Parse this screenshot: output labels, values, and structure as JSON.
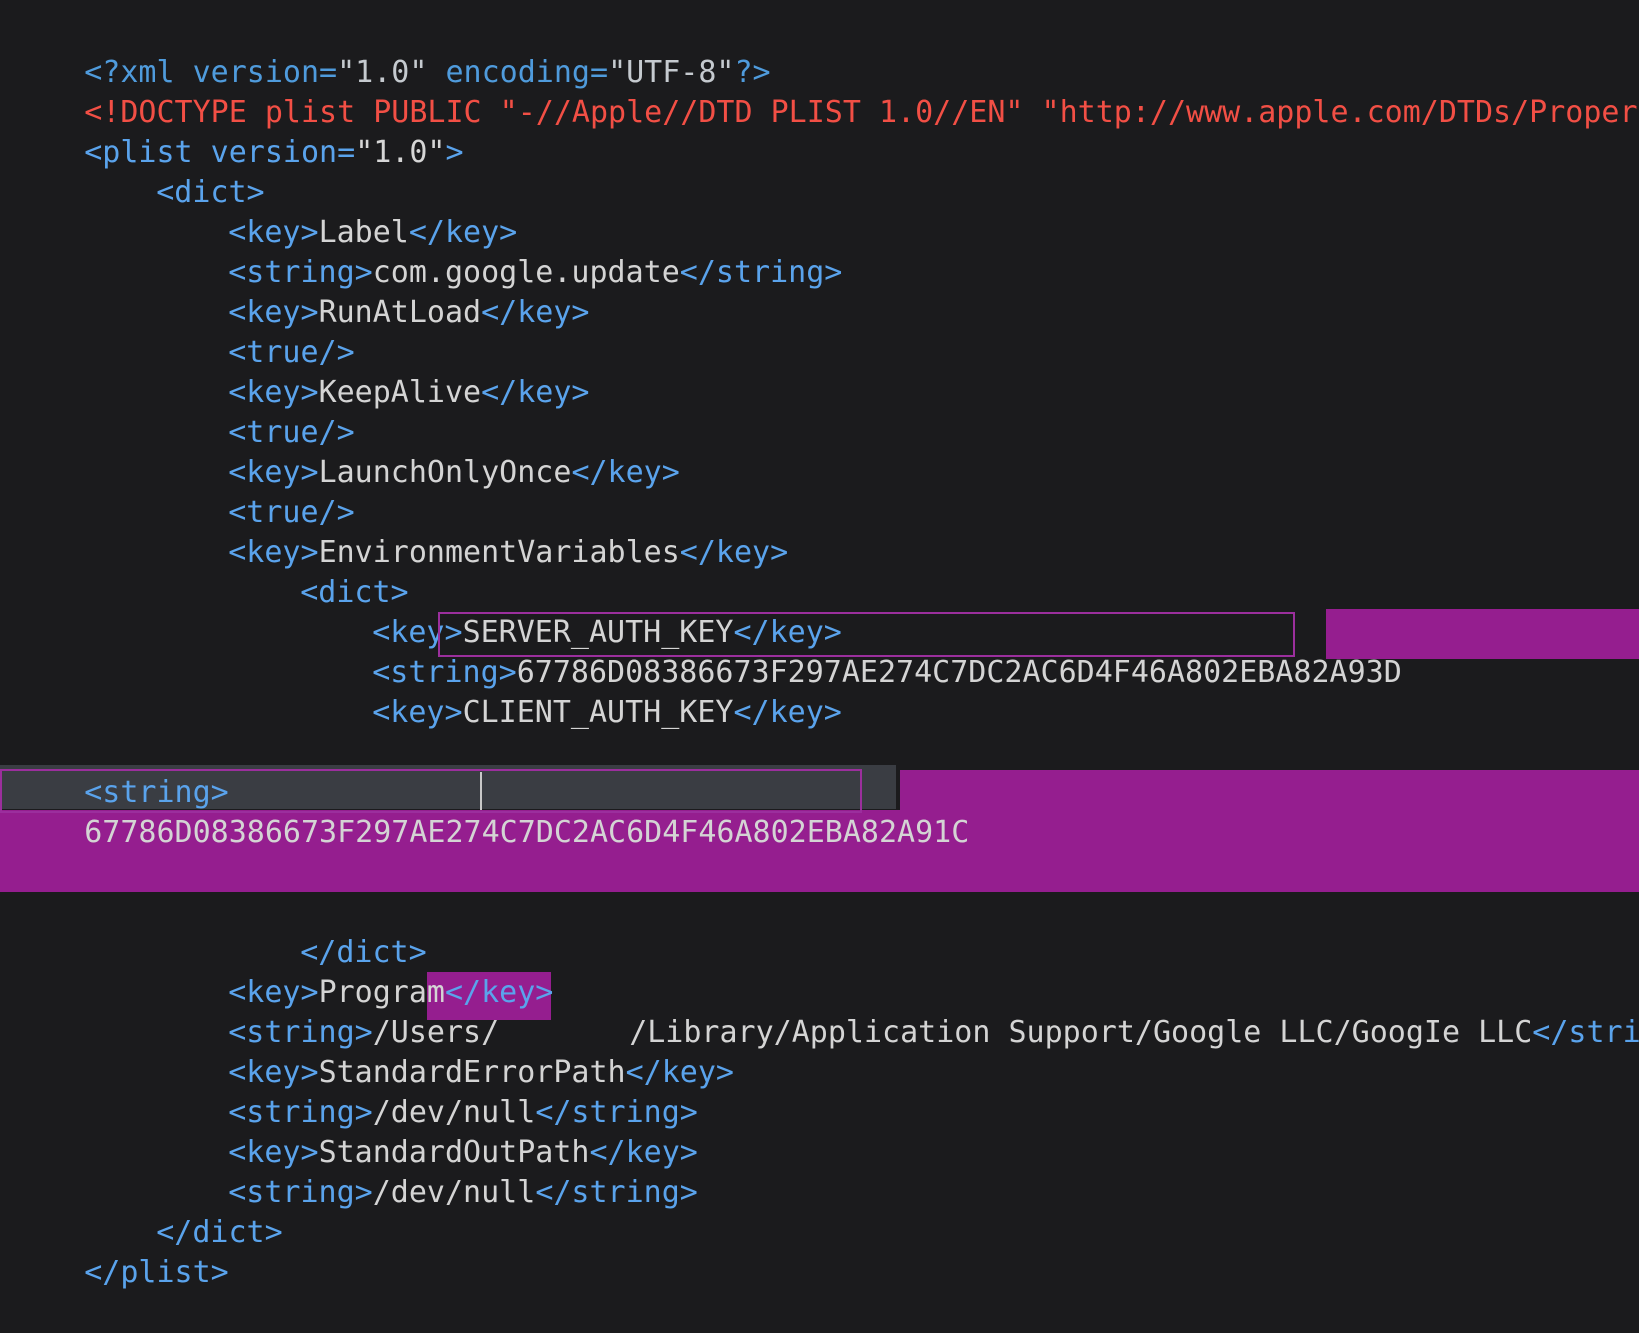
{
  "colors": {
    "background": "#1b1b1d",
    "tag": "#5aa3ec",
    "text": "#d4d4d4",
    "doctype": "#f24f45",
    "redaction": "#951e8f",
    "selection_border": "#9b2f9d"
  },
  "lines": {
    "l1": {
      "open": "<?xml version=",
      "v1": "\"1.0\"",
      "mid": " encoding=",
      "v2": "\"UTF-8\"",
      "close": "?>"
    },
    "l2": {
      "text": "<!DOCTYPE plist PUBLIC \"-//Apple//DTD PLIST 1.0//EN\" \"http://www.apple.com/DTDs/PropertyLi"
    },
    "l3": {
      "open": "<plist",
      "attr": " version=",
      "val": "\"1.0\"",
      "close": ">"
    },
    "l4": {
      "tag": "<dict>"
    },
    "l5": {
      "open": "<key>",
      "val": "Label",
      "close": "</key>"
    },
    "l6": {
      "open": "<string>",
      "val": "com.google.update",
      "close": "</string>"
    },
    "l7": {
      "open": "<key>",
      "val": "RunAtLoad",
      "close": "</key>"
    },
    "l8": {
      "tag": "<true/>"
    },
    "l9": {
      "open": "<key>",
      "val": "KeepAlive",
      "close": "</key>"
    },
    "l10": {
      "tag": "<true/>"
    },
    "l11": {
      "open": "<key>",
      "val": "LaunchOnlyOnce",
      "close": "</key>"
    },
    "l12": {
      "tag": "<true/>"
    },
    "l13": {
      "open": "<key>",
      "val": "EnvironmentVariables",
      "close": "</key>"
    },
    "l14": {
      "tag": "<dict>"
    },
    "l15": {
      "open": "<key>",
      "val": "SERVER_AUTH_KEY",
      "close": "</key>"
    },
    "l16": {
      "open": "<string>",
      "val": "67786D08386673F297AE274C7DC2AC6D4F46A802EBA82A93D"
    },
    "l17": {
      "open": "<key>",
      "val": "CLIENT_AUTH_KEY",
      "close": "</key>"
    },
    "l18": {
      "tag": "<string>"
    },
    "l19": {
      "val_a": "67786D08386673F297AE274C7D",
      "val_b": "C2AC6D4F46A802EBA82A9",
      "val_c": "1C"
    },
    "l20": {
      "tag": "</dict>"
    },
    "l21": {
      "open": "<key>",
      "val": "Program",
      "close": "</key>"
    },
    "l22": {
      "open": "<string>",
      "val_a": "/Users/",
      "val_b": "/Library/Application Support/Google LLC/GoogIe LLC",
      "close": "</string>"
    },
    "l23": {
      "open": "<key>",
      "val": "StandardErrorPath",
      "close": "</key>"
    },
    "l24": {
      "open": "<string>",
      "val": "/dev/null",
      "close": "</string>"
    },
    "l25": {
      "open": "<key>",
      "val": "StandardOutPath",
      "close": "</key>"
    },
    "l26": {
      "open": "<string>",
      "val": "/dev/null",
      "close": "</string>"
    },
    "l27": {
      "tag": "</dict>"
    },
    "l28": {
      "tag": "</plist>"
    }
  }
}
